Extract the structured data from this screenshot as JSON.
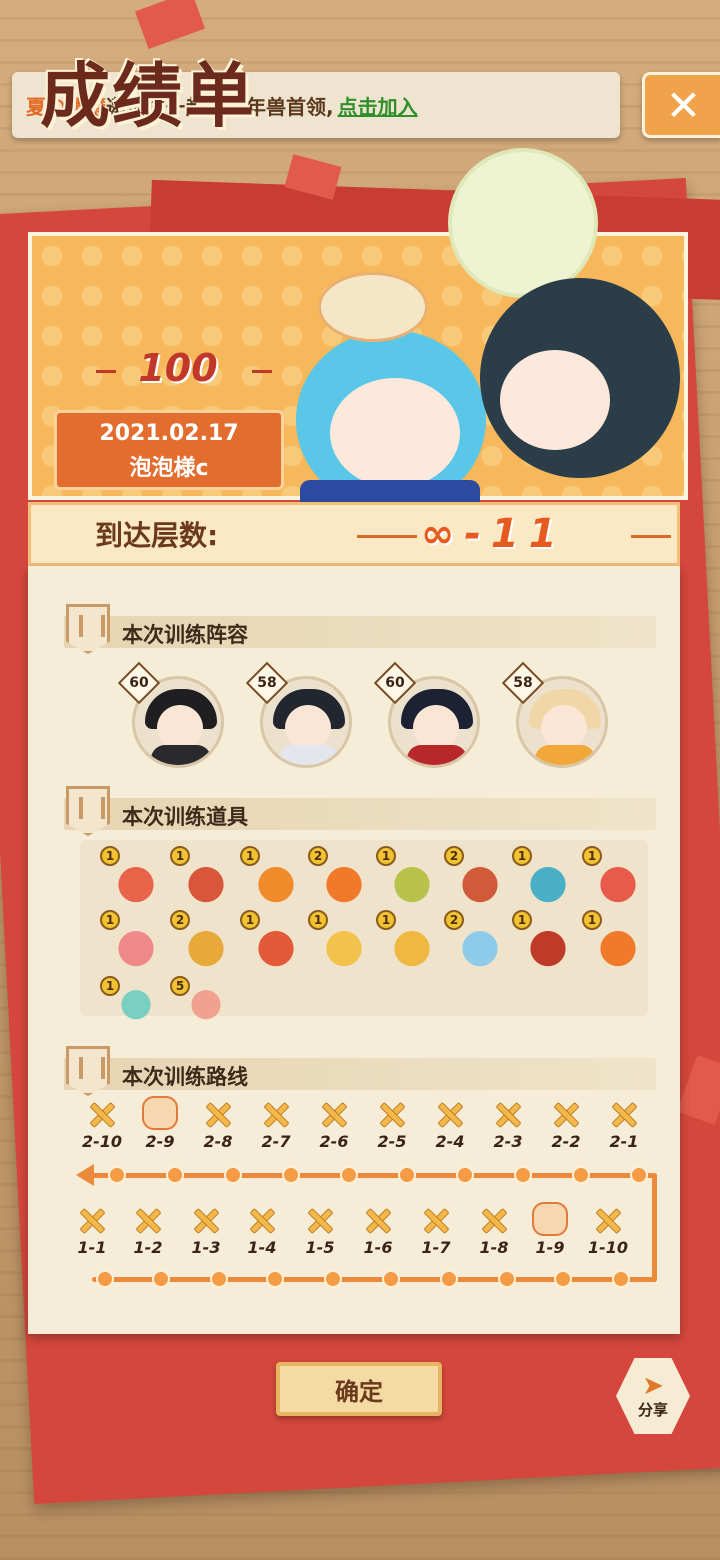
{
  "invite": {
    "name": "夏の憂鬱",
    "message": "邀请您一起挑战年兽首领,",
    "join_link": "点击加入"
  },
  "header": {
    "title": "成绩单",
    "score": "100",
    "date": "2021.02.17",
    "player": "泡泡様c"
  },
  "floor": {
    "label": "到达层数:",
    "value": "∞-11"
  },
  "lineup": {
    "title": "本次训练阵容",
    "heroes": [
      {
        "level": "60",
        "hair": "#1f1f22",
        "body": "#2a2a2e"
      },
      {
        "level": "58",
        "hair": "#22262e",
        "body": "#e4e6ee"
      },
      {
        "level": "60",
        "hair": "#1c2134",
        "body": "#b8282a"
      },
      {
        "level": "58",
        "hair": "#f1d7a8",
        "body": "#f2a73a"
      }
    ]
  },
  "items": {
    "title": "本次训练道具",
    "list": [
      {
        "count": "1",
        "color": "#e7644a",
        "icon": "heart-sword-icon"
      },
      {
        "count": "1",
        "color": "#d8573a",
        "icon": "attack-up-icon"
      },
      {
        "count": "1",
        "color": "#f08a2a",
        "icon": "fire-up-icon"
      },
      {
        "count": "2",
        "color": "#f07a2a",
        "icon": "orange-orb-icon"
      },
      {
        "count": "1",
        "color": "#b8c24a",
        "icon": "sword-box-icon"
      },
      {
        "count": "2",
        "color": "#d05a3a",
        "icon": "blade-icon"
      },
      {
        "count": "1",
        "color": "#4ab0c8",
        "icon": "octopus-icon"
      },
      {
        "count": "1",
        "color": "#e85a4a",
        "icon": "wing-icon"
      },
      {
        "count": "1",
        "color": "#f08a8a",
        "icon": "angel-icon"
      },
      {
        "count": "2",
        "color": "#e8a83a",
        "icon": "flower-up-icon"
      },
      {
        "count": "1",
        "color": "#e25a3a",
        "icon": "star-down-icon"
      },
      {
        "count": "1",
        "color": "#f2c24a",
        "icon": "gold-coin-icon"
      },
      {
        "count": "1",
        "color": "#f0b840",
        "icon": "fan-icon"
      },
      {
        "count": "2",
        "color": "#8ecbea",
        "icon": "snowflake-icon"
      },
      {
        "count": "1",
        "color": "#c03a2a",
        "icon": "defense-down-icon"
      },
      {
        "count": "1",
        "color": "#f07a2a",
        "icon": "wing-fire-icon"
      },
      {
        "count": "1",
        "color": "#7ad0c0",
        "icon": "potion-icon"
      },
      {
        "count": "5",
        "color": "#f2a090",
        "icon": "bird-icon"
      }
    ]
  },
  "route": {
    "title": "本次训练路线",
    "top_row": [
      "2-10",
      "2-9",
      "2-8",
      "2-7",
      "2-6",
      "2-5",
      "2-4",
      "2-3",
      "2-2",
      "2-1"
    ],
    "bottom_row": [
      "1-1",
      "1-2",
      "1-3",
      "1-4",
      "1-5",
      "1-6",
      "1-7",
      "1-8",
      "1-9",
      "1-10"
    ],
    "boss_stages": [
      "2-9",
      "1-9"
    ]
  },
  "buttons": {
    "confirm": "确定",
    "share": "分享",
    "close": "✕"
  }
}
